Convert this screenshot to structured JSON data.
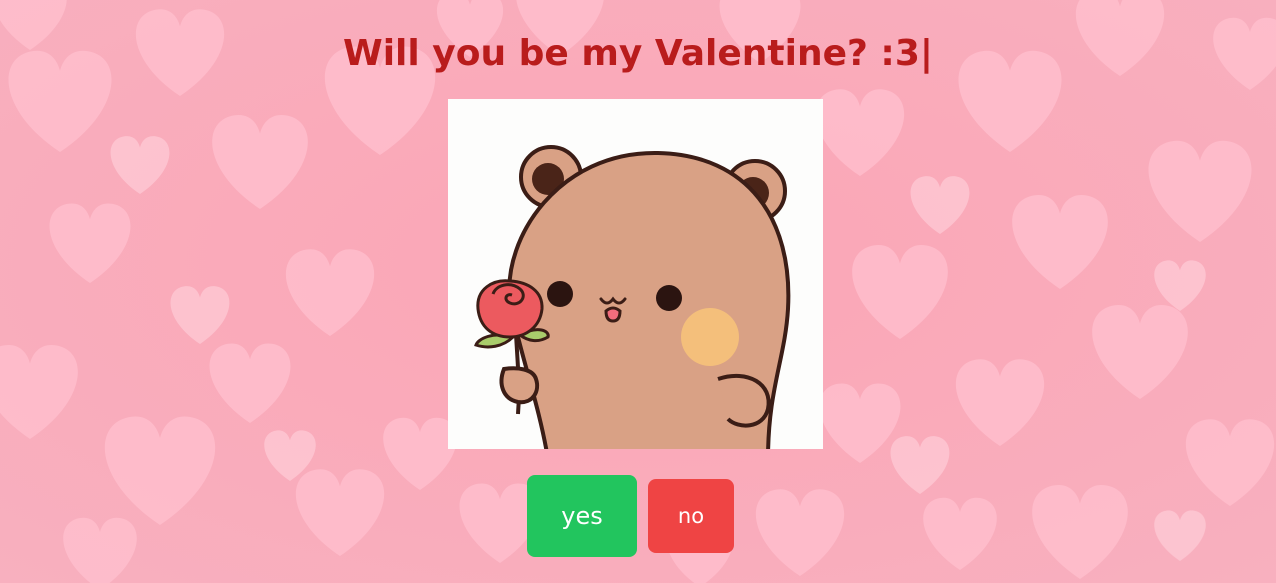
{
  "page": {
    "heading": "Will you be my Valentine? :3|"
  },
  "illustration": {
    "subject": "bear-holding-rose"
  },
  "buttons": {
    "yes_label": "yes",
    "no_label": "no"
  },
  "colors": {
    "background": "#f9a9b8",
    "heart": "#ffc4d1",
    "title": "#b91c1c",
    "yes_button": "#22c55e",
    "no_button": "#ef4444"
  }
}
